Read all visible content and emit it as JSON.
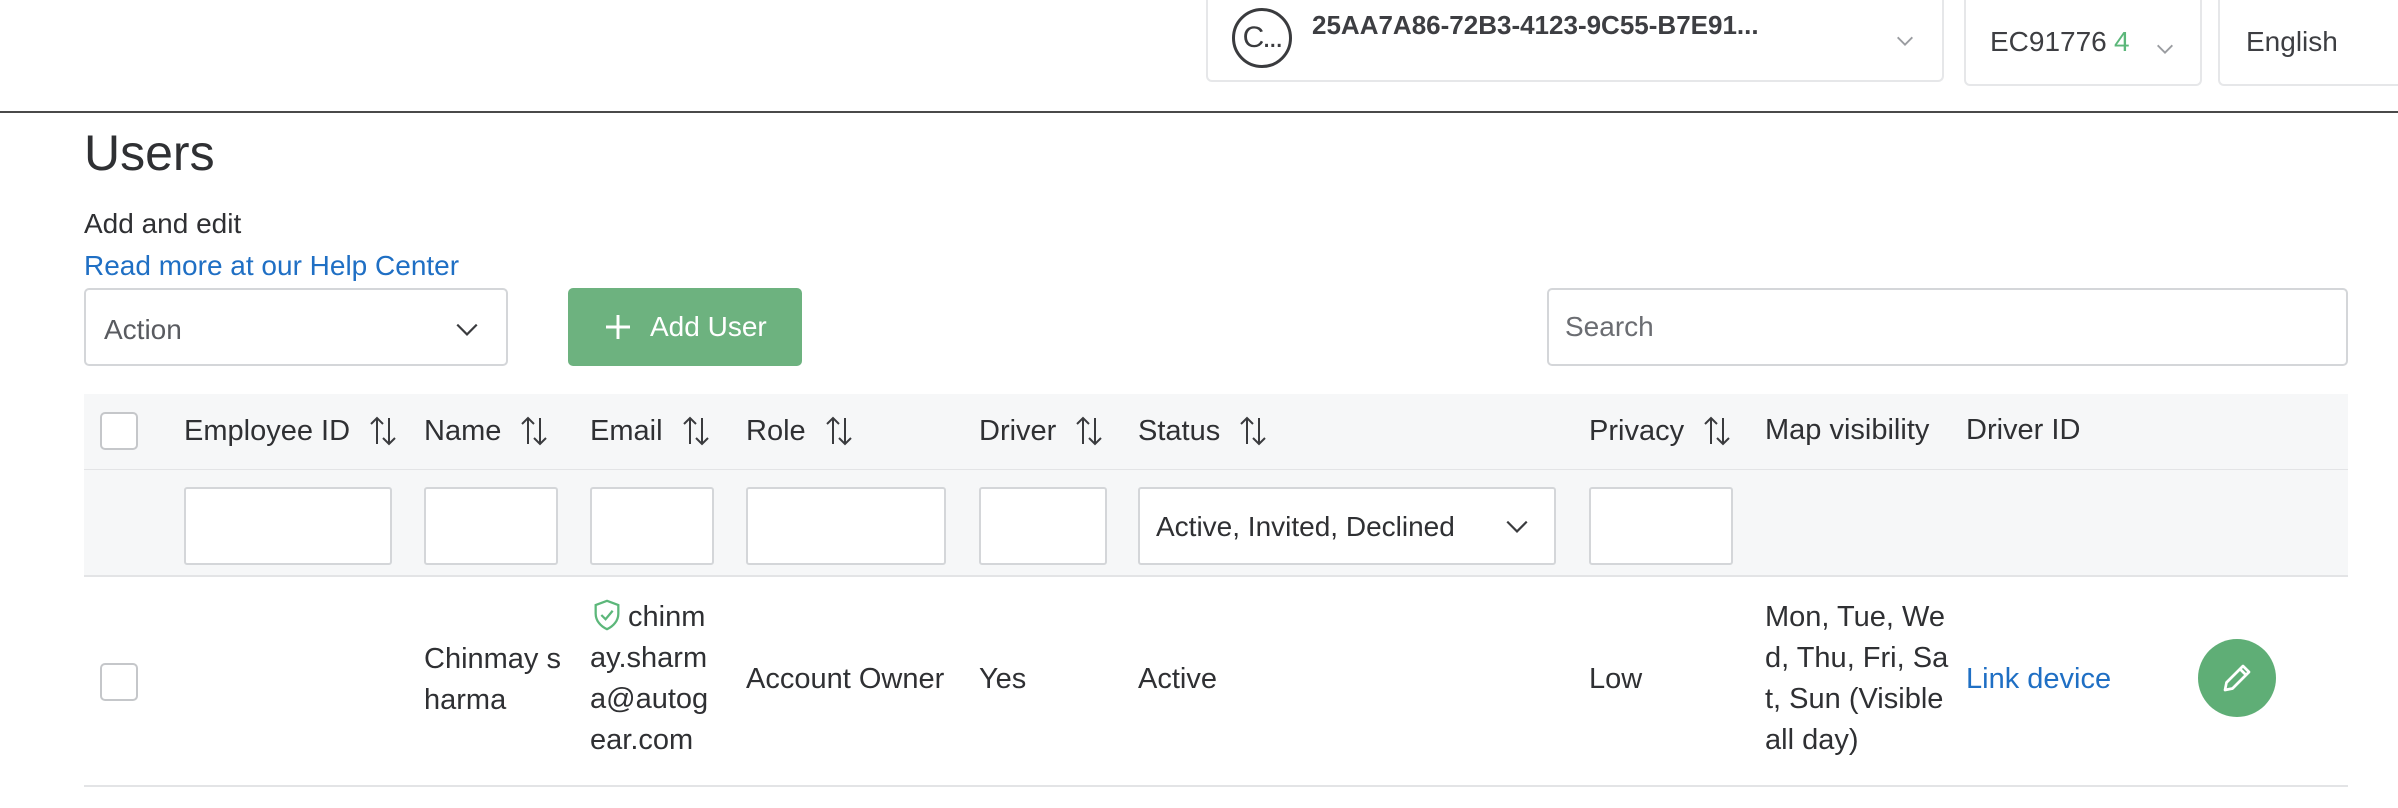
{
  "topbar": {
    "account_avatar_text": "C...",
    "account_id": "25AA7A86-72B3-4123-9C55-B7E91...",
    "database_name": "EC91776",
    "database_count": "4",
    "language": "English"
  },
  "header": {
    "title": "Users",
    "subtitle": "Add and edit",
    "help_link": "Read more at our Help Center"
  },
  "toolbar": {
    "action_label": "Action",
    "add_user_label": "Add User",
    "search_placeholder": "Search"
  },
  "table": {
    "columns": [
      "Employee ID",
      "Name",
      "Email",
      "Role",
      "Driver",
      "Status",
      "Privacy",
      "Map visibility",
      "Driver ID"
    ],
    "status_filter_value": "Active, Invited, Declined",
    "rows": [
      {
        "employee_id": "",
        "name": "Chinmay sharma",
        "email": "chinmay.sharma@autogear.com",
        "role": "Account Owner",
        "driver": "Yes",
        "status": "Active",
        "privacy": "Low",
        "map_visibility": "Mon, Tue, Wed, Thu, Fri, Sat, Sun (Visible all day)",
        "driver_id_link": "Link device"
      }
    ]
  },
  "colors": {
    "accent_green": "#6db27f",
    "link_blue": "#1f6fc4",
    "verified_green": "#5cb77a"
  },
  "icons": [
    "chevron-down-icon",
    "plus-icon",
    "sort-icon",
    "shield-check-icon",
    "pencil-icon"
  ]
}
